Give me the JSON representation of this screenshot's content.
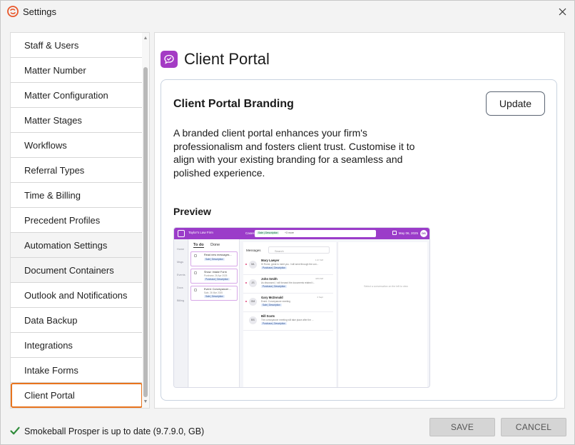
{
  "window": {
    "title": "Settings",
    "logo_icon": "smokeball-logo-icon",
    "close_icon": "close-icon"
  },
  "sidebar": {
    "items": [
      {
        "label": "Staff & Users"
      },
      {
        "label": "Matter Number"
      },
      {
        "label": "Matter Configuration"
      },
      {
        "label": "Matter Stages"
      },
      {
        "label": "Workflows"
      },
      {
        "label": "Referral Types"
      },
      {
        "label": "Time & Billing"
      },
      {
        "label": "Precedent Profiles"
      },
      {
        "label": "Automation Settings"
      },
      {
        "label": "Document Containers"
      },
      {
        "label": "Outlook and Notifications"
      },
      {
        "label": "Data Backup"
      },
      {
        "label": "Integrations"
      },
      {
        "label": "Intake Forms"
      },
      {
        "label": "Client Portal"
      }
    ],
    "selected": "Client Portal",
    "scroll_up_glyph": "▲",
    "scroll_down_glyph": "▼"
  },
  "content": {
    "title": "Client Portal",
    "icon": "chat-bubble-icon",
    "card": {
      "title": "Client Portal Branding",
      "update_label": "Update",
      "description": "A branded client portal enhances your firm's professionalism and fosters client trust. Customise it to align with your existing branding for a seamless and polished experience.",
      "preview_label": "Preview"
    }
  },
  "preview": {
    "firm_name": "Taylor's Law Firm",
    "cases_label": "Cases",
    "case_chip": "Sale | Description",
    "more_chip": "+3 more",
    "date": "May 06, 2025",
    "avatar_initials": "DS",
    "rail": [
      "Home",
      "Msgs",
      "Events",
      "Docs",
      "Billing"
    ],
    "tabs": [
      "To do",
      "Done"
    ],
    "tasks": [
      {
        "title": "Read new messages...",
        "sub": "",
        "chip": "Sale | Description"
      },
      {
        "title": "Show: Intake Form",
        "sub": "Purchase, 26 Apr 2025",
        "chip": "Purchase | Description"
      },
      {
        "title": "Event: Conveyancer ...",
        "sub": "Sale, 26 Mar 2025",
        "chip": "Sale | Description"
      }
    ],
    "messages_label": "Messages",
    "search_placeholder": "Search",
    "messages": [
      {
        "initials": "ML",
        "name": "Mary Lawyer",
        "time": "1:27 AM",
        "snippet": "Hi Rome, great to meet you. I will send through the con...",
        "chip": "Purchase | Description",
        "unread": true
      },
      {
        "initials": "JS",
        "name": "John Smith",
        "time": "4/23 AM",
        "snippet": "As discussed, I will forward the documents related t...",
        "chip": "Purchase | Description",
        "unread": true
      },
      {
        "initials": "GM",
        "name": "Gary McDonald",
        "time": "4 Sept",
        "snippet": "Event: Conveyancer meeting",
        "chip": "Sale | Description",
        "unread": true
      },
      {
        "initials": "BS",
        "name": "Bill Scots",
        "time": "",
        "snippet": "The conveyancer meeting will take place after the ...",
        "chip": "Purchase | Description",
        "unread": false
      }
    ],
    "detail_placeholder": "Select a conversation on the left to view"
  },
  "footer": {
    "status_text": "Smokeball Prosper is up to date (9.7.9.0, GB)",
    "status_icon": "checkmark-icon",
    "save_label": "SAVE",
    "cancel_label": "CANCEL"
  },
  "colors": {
    "accent_selected": "#e8741e",
    "portal_purple": "#a43bc4",
    "status_green": "#2e8b3a"
  }
}
